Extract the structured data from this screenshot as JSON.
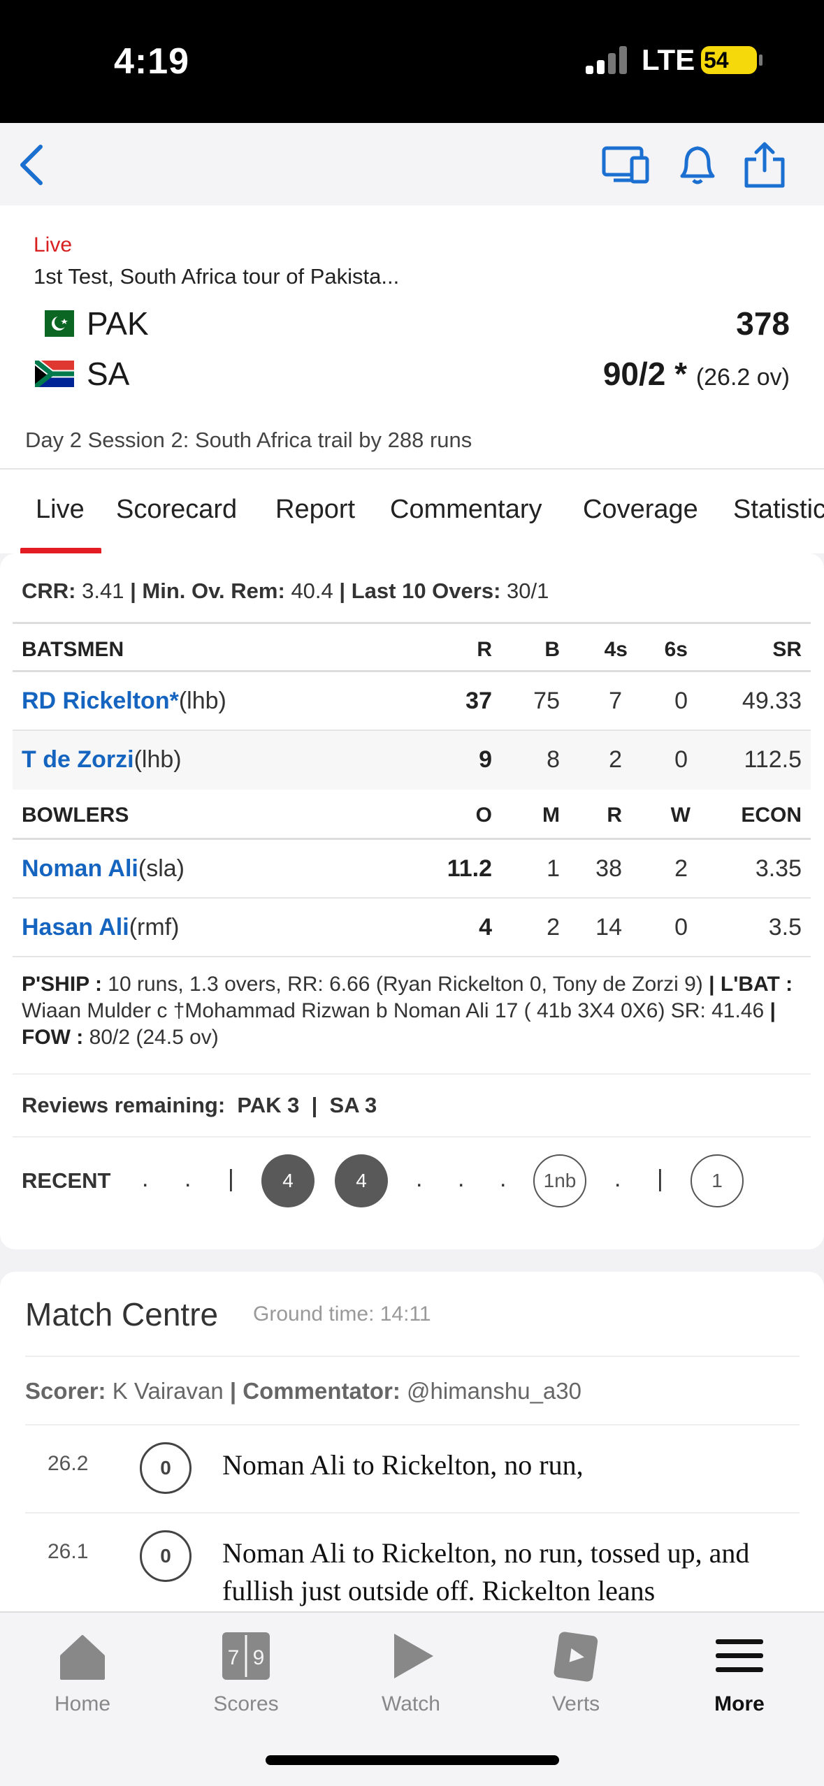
{
  "status_bar": {
    "time": "4:19",
    "network": "LTE",
    "battery": "54"
  },
  "nav": {
    "icons": [
      "back-icon",
      "cast-icon",
      "bell-icon",
      "share-icon"
    ]
  },
  "match": {
    "status": "Live",
    "title": "1st Test, South Africa tour of Pakista...",
    "teams": [
      {
        "name": "PAK",
        "score": "378",
        "overs": ""
      },
      {
        "name": "SA",
        "score": "90/2 *",
        "overs": "(26.2 ov)"
      }
    ],
    "session_info": "Day 2 Session 2: South Africa trail by 288 runs"
  },
  "tabs": [
    "Live",
    "Scorecard",
    "Report",
    "Commentary",
    "Coverage",
    "Statistics"
  ],
  "live": {
    "crr_label": "CRR:",
    "crr": "3.41",
    "min_ov_label": "Min. Ov. Rem:",
    "min_ov": "40.4",
    "last10_label": "Last 10 Overs:",
    "last10": "30/1",
    "batsmen_header": [
      "BATSMEN",
      "R",
      "B",
      "4s",
      "6s",
      "SR"
    ],
    "batsmen": [
      {
        "name": "RD Rickelton*",
        "style": "(lhb)",
        "r": "37",
        "b": "75",
        "fours": "7",
        "sixes": "0",
        "sr": "49.33"
      },
      {
        "name": "T de Zorzi",
        "style": "(lhb)",
        "r": "9",
        "b": "8",
        "fours": "2",
        "sixes": "0",
        "sr": "112.5"
      }
    ],
    "bowlers_header": [
      "BOWLERS",
      "O",
      "M",
      "R",
      "W",
      "ECON"
    ],
    "bowlers": [
      {
        "name": "Noman Ali",
        "style": "(sla)",
        "o": "11.2",
        "m": "1",
        "r": "38",
        "w": "2",
        "econ": "3.35"
      },
      {
        "name": "Hasan Ali",
        "style": "(rmf)",
        "o": "4",
        "m": "2",
        "r": "14",
        "w": "0",
        "econ": "3.5"
      }
    ],
    "pship_label": "P'SHIP :",
    "pship": "10 runs, 1.3 overs, RR: 6.66 (Ryan Rickelton 0, Tony de Zorzi 9)",
    "lbat_label": "L'BAT :",
    "lbat": "Wiaan Mulder c †Mohammad Rizwan b Noman Ali 17 ( 41b 3X4 0X6) SR: 41.46",
    "fow_label": "FOW :",
    "fow": "80/2 (24.5 ov)",
    "reviews_label": "Reviews remaining:",
    "reviews_pak": "PAK 3",
    "reviews_sa": "SA 3",
    "recent_label": "RECENT",
    "recent": [
      ".",
      ".",
      "|",
      "4",
      "4",
      ".",
      ".",
      ".",
      "1nb",
      ".",
      "|",
      "1"
    ]
  },
  "match_centre": {
    "title": "Match Centre",
    "ground_time": "Ground time: 14:11",
    "scorer_label": "Scorer:",
    "scorer": "K Vairavan",
    "commentator_label": "Commentator:",
    "commentator": "@himanshu_a30",
    "commentary": [
      {
        "over": "26.2",
        "ball": "0",
        "text": "Noman Ali to Rickelton, no run,"
      },
      {
        "over": "26.1",
        "ball": "0",
        "text": "Noman Ali to Rickelton, no run, tossed up, and fullish just outside off. Rickelton leans"
      }
    ]
  },
  "tabbar": [
    {
      "label": "Home",
      "icon": "home-icon"
    },
    {
      "label": "Scores",
      "icon": "scores-icon"
    },
    {
      "label": "Watch",
      "icon": "play-icon"
    },
    {
      "label": "Verts",
      "icon": "verts-icon"
    },
    {
      "label": "More",
      "icon": "menu-icon"
    }
  ],
  "colors": {
    "live_red": "#d81e1e",
    "link_blue": "#1565c0",
    "accent_red": "#e31b23",
    "nav_blue": "#1a6fd1"
  }
}
